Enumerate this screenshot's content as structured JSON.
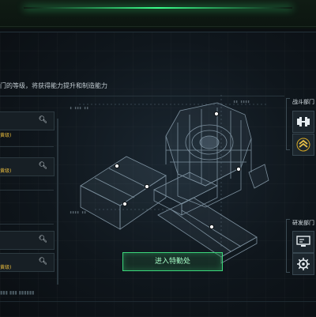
{
  "header": {
    "accent_color": "#3bff8a"
  },
  "panel": {
    "hint_text": "门的等级，将获得能力提升和制造能力",
    "fields": [
      {
        "tier_label": "黄级)"
      },
      {
        "tier_label": "黄级)"
      },
      {
        "tier_label": ""
      },
      {
        "tier_label": "黄级)"
      }
    ],
    "search_icon": "search-icon"
  },
  "main": {
    "enter_button_label": "进入特勤处",
    "button_color": "#3bd67a"
  },
  "departments": {
    "combat_label": "战斗部门",
    "research_label": "研发部门",
    "icons": [
      "dumbbell-icon",
      "chevron-rank-icon",
      "monitor-icon",
      "gear-chip-icon"
    ]
  }
}
